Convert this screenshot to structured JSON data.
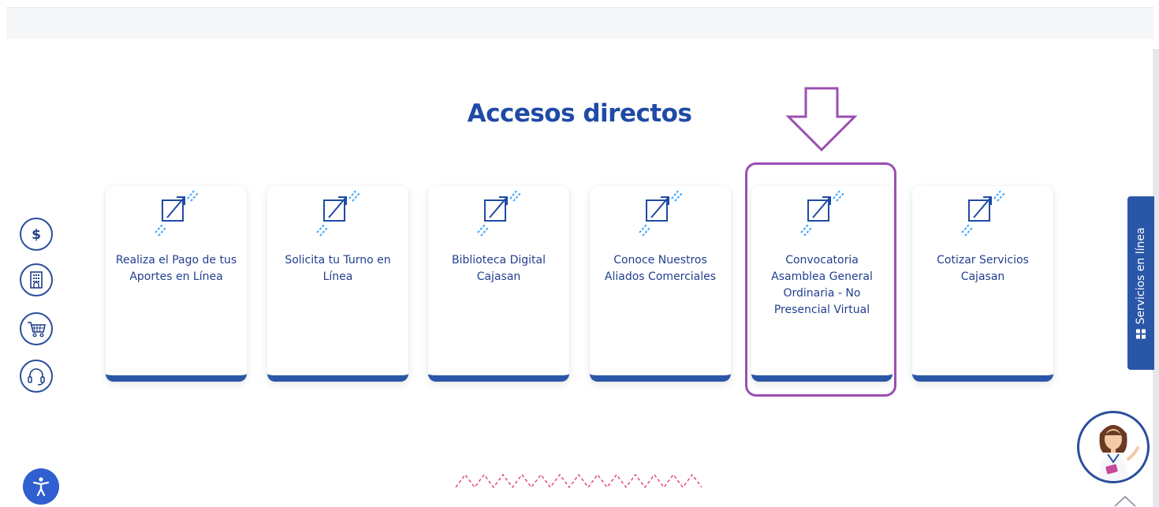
{
  "section": {
    "title": "Accesos directos"
  },
  "cards": [
    {
      "label": "Realiza el Pago de tus Aportes en Línea",
      "icon": "external-link-icon"
    },
    {
      "label": "Solicita tu Turno en Línea",
      "icon": "external-link-icon"
    },
    {
      "label": "Biblioteca Digital Cajasan",
      "icon": "external-link-icon"
    },
    {
      "label": "Conoce Nuestros Aliados Comerciales",
      "icon": "external-link-icon"
    },
    {
      "label": "Convocatoria Asamblea General Ordinaria - No Presencial Virtual",
      "icon": "external-link-icon"
    },
    {
      "label": "Cotizar Servicios Cajasan",
      "icon": "external-link-icon"
    }
  ],
  "floating_buttons": [
    {
      "icon": "dollar-icon"
    },
    {
      "icon": "building-icon"
    },
    {
      "icon": "shopping-cart-icon"
    },
    {
      "icon": "headset-icon"
    }
  ],
  "side_tab": {
    "label": "Servicios en línea",
    "icon": "windows-grid-icon"
  },
  "accessibility_button": {
    "icon": "accessibility-icon"
  },
  "colors": {
    "primary": "#2a56a7",
    "title": "#1f4aa6",
    "card_text": "#23408f",
    "highlight": "#9b4fb0",
    "icon_accent": "#3ea6ff",
    "zigzag": "#e23f7b"
  }
}
